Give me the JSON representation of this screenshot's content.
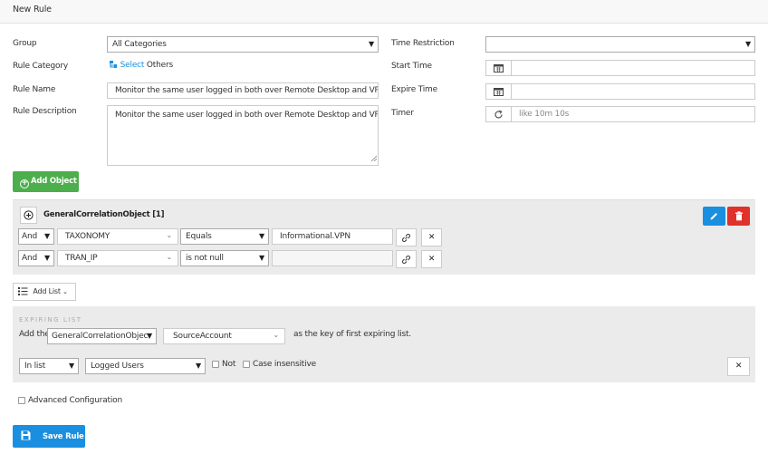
{
  "page": {
    "title": "New Rule"
  },
  "form": {
    "group": {
      "label": "Group",
      "value": "All Categories"
    },
    "rule_category": {
      "label": "Rule Category",
      "select_link": "Select",
      "value": "Others"
    },
    "rule_name": {
      "label": "Rule Name",
      "value": "Monitor the same user logged in both over Remote Desktop and VPN"
    },
    "rule_description": {
      "label": "Rule Description",
      "value": "Monitor the same user logged in both over Remote Desktop and VPN"
    },
    "time_restriction": {
      "label": "Time Restriction",
      "value": ""
    },
    "start_time": {
      "label": "Start Time",
      "value": ""
    },
    "expire_time": {
      "label": "Expire Time",
      "value": ""
    },
    "timer": {
      "label": "Timer",
      "placeholder": "like 10m 10s"
    }
  },
  "add_object": {
    "label": "Add Object"
  },
  "correlation_object": {
    "title": "GeneralCorrelationObject [1]",
    "rows": [
      {
        "logic": "And",
        "field": "TAXONOMY",
        "operator": "Equals",
        "value": "Informational.VPN"
      },
      {
        "logic": "And",
        "field": "TRAN_IP",
        "operator": "is not null",
        "value": ""
      }
    ],
    "remove_symbol": "✕"
  },
  "add_list": {
    "label": "Add List"
  },
  "expiring_list": {
    "header": "EXPIRING LIST",
    "prefix": "Add the",
    "object": "GeneralCorrelationObjec",
    "key": "SourceAccount",
    "suffix": "as the key of first expiring list.",
    "in_list": "In list",
    "list_name": "Logged Users",
    "not_label": "Not",
    "case_label": "Case insensitive",
    "remove_symbol": "✕"
  },
  "advanced": {
    "label": "Advanced Configuration"
  },
  "save": {
    "label": "Save Rule"
  },
  "colors": {
    "green": "#4cae4c",
    "blue": "#1a8fe0",
    "red": "#e0312a",
    "link": "#1a8fe0"
  }
}
